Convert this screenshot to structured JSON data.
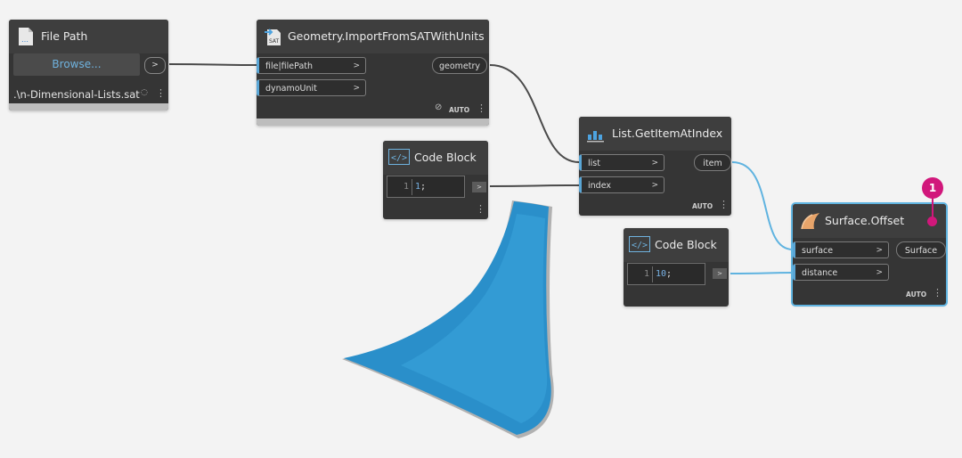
{
  "nodes": {
    "file_path": {
      "title": "File Path",
      "browse_label": "Browse...",
      "out_label": ">",
      "path_value": ".\\n-Dimensional-Lists.sat"
    },
    "import_sat": {
      "title": "Geometry.ImportFromSATWithUnits",
      "inputs": [
        "file|filePath",
        "dynamoUnit"
      ],
      "output": "geometry",
      "lacing": "AUTO"
    },
    "code_block_1": {
      "title": "Code Block",
      "line_no": "1",
      "code_value": "1",
      "code_suffix": ";",
      "out_label": ">"
    },
    "get_item": {
      "title": "List.GetItemAtIndex",
      "inputs": [
        "list",
        "index"
      ],
      "output": "item",
      "lacing": "AUTO"
    },
    "code_block_2": {
      "title": "Code Block",
      "line_no": "1",
      "code_value": "10",
      "code_suffix": ";",
      "out_label": ">"
    },
    "surface_offset": {
      "title": "Surface.Offset",
      "inputs": [
        "surface",
        "distance"
      ],
      "output": "Surface",
      "lacing": "AUTO"
    }
  },
  "callout": {
    "number": "1"
  },
  "colors": {
    "canvas": "#f3f3f3",
    "node_body": "#353535",
    "node_header": "#3e3e3e",
    "wire": "#4a4a4a",
    "selected_wire": "#5fb3e0",
    "badge": "#d1177b",
    "surface_preview": "#2a8fca"
  },
  "icons": {
    "file_path": "file-document-icon",
    "import_sat": "sat-import-icon",
    "code_block": "code-brackets-icon",
    "get_item": "list-index-icon",
    "surface_offset": "surface-icon",
    "preview_toggle": "eye-hidden-icon",
    "menu": "vertical-ellipsis-icon"
  }
}
